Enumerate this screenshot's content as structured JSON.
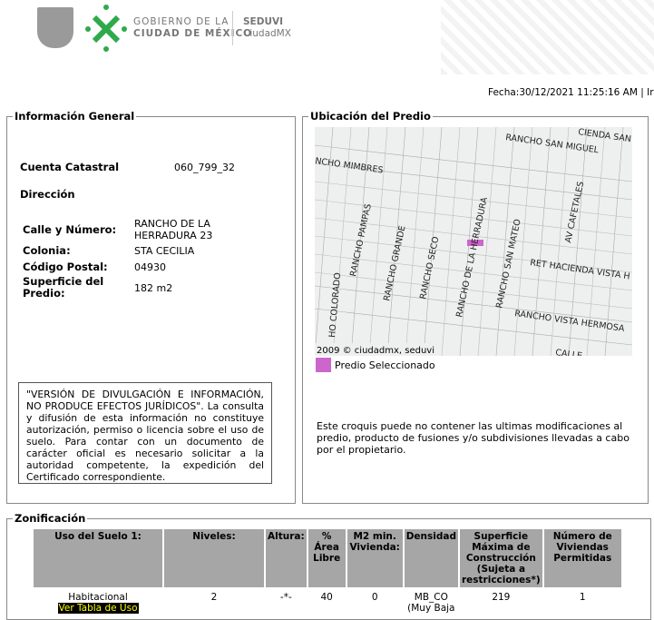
{
  "header": {
    "logo_text_1": "GOBIERNO DE LA",
    "logo_text_2": "CIUDAD DE MÉXICO",
    "logo_text_3": "SEDUVI",
    "logo_text_4": "CiudadMX",
    "fecha": "Fecha:30/12/2021 11:25:16 AM | Ir"
  },
  "info": {
    "title": "Información General",
    "cuenta_label": "Cuenta Catastral",
    "cuenta_value": "060_799_32",
    "direccion_label": "Dirección",
    "calle_label": "Calle y Número:",
    "calle_value_1": "RANCHO DE LA",
    "calle_value_2": "HERRADURA 23",
    "colonia_label": "Colonia:",
    "colonia_value": "STA CECILIA",
    "cp_label": "Código Postal:",
    "cp_value": "04930",
    "sup_label_1": "Superficie del",
    "sup_label_2": "Predio:",
    "sup_value": "182 m2",
    "notice": "\"VERSIÓN DE DIVULGACIÓN E INFORMACIÓN, NO PRODUCE EFECTOS JURÍDICOS\". La consulta y difusión de esta información no constituye autorización, permiso o licencia sobre el uso de suelo. Para contar con un documento de carácter oficial es necesario solicitar a la autoridad competente, la expedición del Certificado correspondiente."
  },
  "ubicacion": {
    "title": "Ubicación del Predio",
    "copyright": "2009 © ciudadmx, seduvi",
    "legend": "Predio Seleccionado",
    "legend_color": "#cc66cc",
    "streets": [
      "RANCHO SAN MIGUEL",
      "NCHO MIMBRES",
      "RANCHO PAMPAS",
      "RANCHO GRANDE",
      "RANCHO SECO",
      "RANCHO DE LA HERRADURA",
      "RANCHO SAN MATEO",
      "AV CAFETALES",
      "RET HACIENDA VISTA H",
      "RANCHO VISTA HERMOSA",
      "HO COLORADO",
      "CIENDA SAN",
      "CALLE"
    ],
    "note": "Este croquis puede no contener las ultimas modificaciones al predio, producto de fusiones y/o subdivisiones llevadas a cabo por el propietario."
  },
  "zonificacion": {
    "title": "Zonificación",
    "headers": [
      "Uso del Suelo 1:",
      "Niveles:",
      "Altura:",
      "% Área Libre",
      "M2 min. Vivienda:",
      "Densidad",
      "Superficie Máxima de Construcción (Sujeta a restricciones*)",
      "Número de Viviendas Permitidas"
    ],
    "row": {
      "uso": "Habitacional",
      "link": "Ver Tabla de Uso",
      "niveles": "2",
      "altura": "-*-",
      "area_libre": "40",
      "m2": "0",
      "densidad_1": "MB_CO",
      "densidad_2": "(Muy Baja",
      "superficie": "219",
      "viviendas": "1"
    }
  }
}
